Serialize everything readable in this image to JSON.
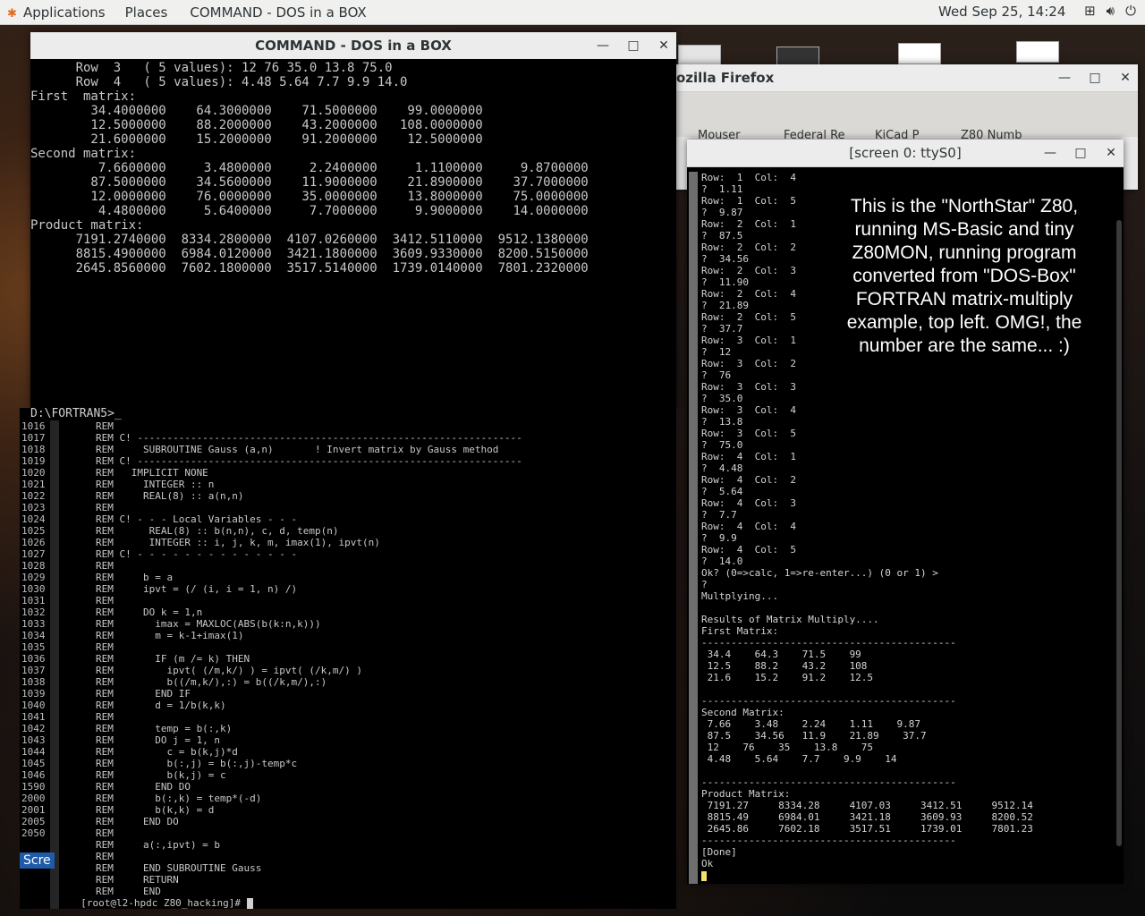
{
  "topbar": {
    "applications": "Applications",
    "places": "Places",
    "active_window": "COMMAND - DOS in a BOX",
    "clock": "Wed Sep 25, 14:24"
  },
  "dos_window": {
    "title": "COMMAND - DOS in a BOX",
    "lines": [
      "      Row  3   ( 5 values): 12 76 35.0 13.8 75.0",
      "      Row  4   ( 5 values): 4.48 5.64 7.7 9.9 14.0",
      "First  matrix:",
      "        34.4000000    64.3000000    71.5000000    99.0000000",
      "        12.5000000    88.2000000    43.2000000   108.0000000",
      "        21.6000000    15.2000000    91.2000000    12.5000000",
      "Second matrix:",
      "         7.6600000     3.4800000     2.2400000     1.1100000     9.8700000",
      "        87.5000000    34.5600000    11.9000000    21.8900000    37.7000000",
      "        12.0000000    76.0000000    35.0000000    13.8000000    75.0000000",
      "         4.4800000     5.6400000     7.7000000     9.9000000    14.0000000",
      "Product matrix:",
      "      7191.2740000  8334.2800000  4107.0260000  3412.5110000  9512.1380000",
      "      8815.4900000  6984.0120000  3421.1800000  3609.9330000  8200.5150000",
      "      2645.8560000  7602.1800000  3517.5140000  1739.0140000  7801.2320000"
    ],
    "prompt": "D:\\FORTRAN5>_"
  },
  "firefox_window": {
    "title": "ozilla Firefox",
    "tabs": [
      "Mouser",
      "Federal Re",
      "KiCad P",
      "Z80 Numb"
    ]
  },
  "screen_window": {
    "title": "[screen 0: ttyS0]",
    "overlay_text": "This is the \"NorthStar\" Z80, running MS-Basic and tiny Z80MON, running program converted from \"DOS-Box\" FORTRAN matrix-multiply example, top left.  OMG!, the number are the same...  :)",
    "lines": [
      "Row:  1  Col:  4",
      "?  1.11",
      "Row:  1  Col:  5",
      "?  9.87",
      "Row:  2  Col:  1",
      "?  87.5",
      "Row:  2  Col:  2",
      "?  34.56",
      "Row:  2  Col:  3",
      "?  11.90",
      "Row:  2  Col:  4",
      "?  21.89",
      "Row:  2  Col:  5",
      "?  37.7",
      "Row:  3  Col:  1",
      "?  12",
      "Row:  3  Col:  2",
      "?  76",
      "Row:  3  Col:  3",
      "?  35.0",
      "Row:  3  Col:  4",
      "?  13.8",
      "Row:  3  Col:  5",
      "?  75.0",
      "Row:  4  Col:  1",
      "?  4.48",
      "Row:  4  Col:  2",
      "?  5.64",
      "Row:  4  Col:  3",
      "?  7.7",
      "Row:  4  Col:  4",
      "?  9.9",
      "Row:  4  Col:  5",
      "?  14.0",
      "Ok? (0=>calc, 1=>re-enter...) (0 or 1) >",
      "?",
      "Multplying...",
      "",
      "Results of Matrix Multiply....",
      "First Matrix:",
      "-------------------------------------------",
      " 34.4    64.3    71.5    99",
      " 12.5    88.2    43.2    108",
      " 21.6    15.2    91.2    12.5",
      "",
      "-------------------------------------------",
      "Second Matrix:",
      " 7.66    3.48    2.24    1.11    9.87",
      " 87.5    34.56   11.9    21.89    37.7",
      " 12    76    35    13.8    75",
      " 4.48    5.64    7.7    9.9    14",
      "",
      "-------------------------------------------",
      "Product Matrix:",
      " 7191.27     8334.28     4107.03     3412.51     9512.14",
      " 8815.49     6984.01     3421.18     3609.93     8200.52",
      " 2645.86     7602.18     3517.51     1739.01     7801.23",
      "-------------------------------------------",
      "[Done]",
      "Ok"
    ]
  },
  "bottom_terminal": {
    "line_numbers": [
      "1016",
      "1017",
      "1018",
      "1019",
      "1020",
      "1021",
      "1022",
      "1023",
      "1024",
      "1025",
      "1026",
      "1027",
      "1028",
      "1029",
      "1030",
      "1031",
      "1032",
      "1033",
      "1034",
      "1035",
      "1036",
      "1037",
      "1038",
      "1039",
      "1040",
      "1041",
      "1042",
      "1043",
      "1044",
      "1045",
      "1046",
      "1590",
      "2000",
      "2001",
      "2005",
      "2050"
    ],
    "lines": [
      "REM",
      "REM C! -----------------------------------------------------------------",
      "REM     SUBROUTINE Gauss (a,n)       ! Invert matrix by Gauss method",
      "REM C! -----------------------------------------------------------------",
      "REM   IMPLICIT NONE",
      "REM     INTEGER :: n",
      "REM     REAL(8) :: a(n,n)",
      "REM",
      "REM C! - - - Local Variables - - -",
      "REM      REAL(8) :: b(n,n), c, d, temp(n)",
      "REM      INTEGER :: i, j, k, m, imax(1), ipvt(n)",
      "REM C! - - - - - - - - - - - - - -",
      "REM",
      "REM     b = a",
      "REM     ipvt = (/ (i, i = 1, n) /)",
      "REM",
      "REM     DO k = 1,n",
      "REM       imax = MAXLOC(ABS(b(k:n,k)))",
      "REM       m = k-1+imax(1)",
      "REM",
      "REM       IF (m /= k) THEN",
      "REM         ipvt( (/m,k/) ) = ipvt( (/k,m/) )",
      "REM         b((/m,k/),:) = b((/k,m/),:)",
      "REM       END IF",
      "REM       d = 1/b(k,k)",
      "REM",
      "REM       temp = b(:,k)",
      "REM       DO j = 1, n",
      "REM         c = b(k,j)*d",
      "REM         b(:,j) = b(:,j)-temp*c",
      "REM         b(k,j) = c",
      "REM       END DO",
      "REM       b(:,k) = temp*(-d)",
      "REM       b(k,k) = d",
      "REM     END DO",
      "REM",
      "REM     a(:,ipvt) = b",
      "REM",
      "REM     END SUBROUTINE Gauss",
      "REM     RETURN",
      "REM     END"
    ],
    "prompt": "[root@l2-hpdc Z80_hacking]# ",
    "side_label": "Scre"
  }
}
